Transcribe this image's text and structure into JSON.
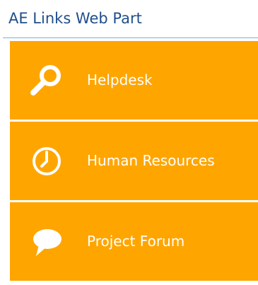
{
  "webpart": {
    "title": "AE Links Web Part",
    "accent_color": "#FFA500",
    "title_color": "#1F4E8C"
  },
  "links": [
    {
      "label": "Helpdesk",
      "icon": "search-icon"
    },
    {
      "label": "Human Resources",
      "icon": "clock-icon"
    },
    {
      "label": "Project Forum",
      "icon": "speech-bubble-icon"
    }
  ]
}
